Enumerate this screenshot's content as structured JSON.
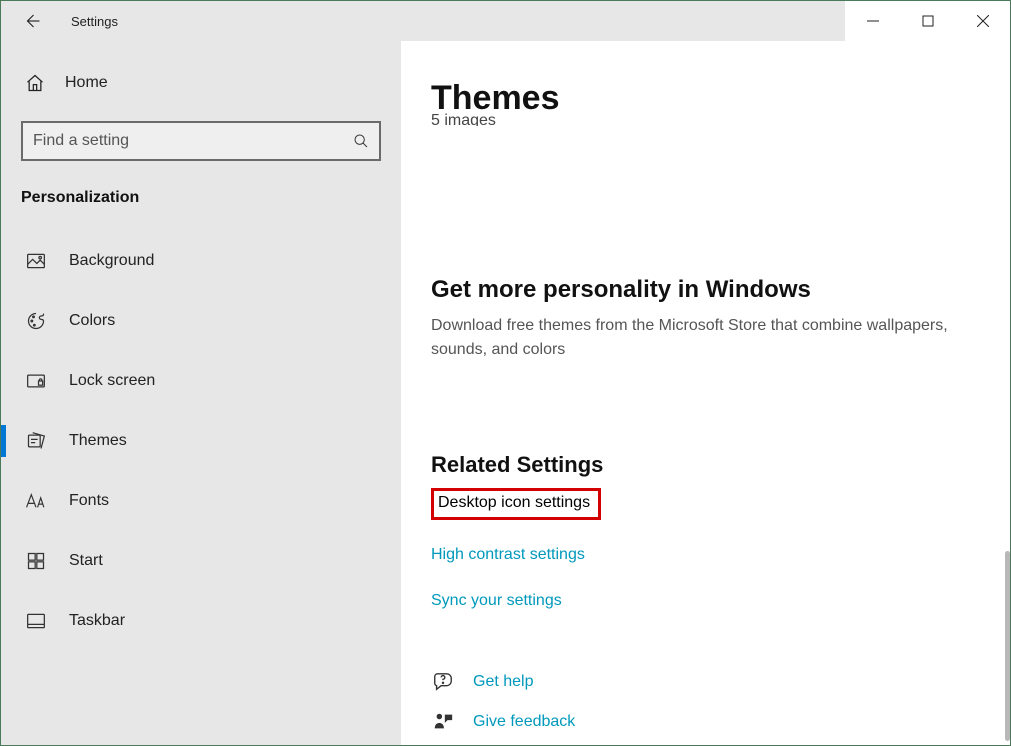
{
  "window": {
    "title": "Settings"
  },
  "sidebar": {
    "home_label": "Home",
    "search_placeholder": "Find a setting",
    "section_label": "Personalization",
    "items": [
      {
        "label": "Background",
        "icon": "image-icon",
        "active": false
      },
      {
        "label": "Colors",
        "icon": "palette-icon",
        "active": false
      },
      {
        "label": "Lock screen",
        "icon": "lockscreen-icon",
        "active": false
      },
      {
        "label": "Themes",
        "icon": "themes-icon",
        "active": true
      },
      {
        "label": "Fonts",
        "icon": "fonts-icon",
        "active": false
      },
      {
        "label": "Start",
        "icon": "start-icon",
        "active": false
      },
      {
        "label": "Taskbar",
        "icon": "taskbar-icon",
        "active": false
      }
    ]
  },
  "main": {
    "title": "Themes",
    "clipped_line": "5 images",
    "more_title": "Get more personality in Windows",
    "more_desc": "Download free themes from the Microsoft Store that combine wallpapers, sounds, and colors",
    "related_title": "Related Settings",
    "links": [
      "Desktop icon settings",
      "High contrast settings",
      "Sync your settings"
    ],
    "help_label": "Get help",
    "feedback_label": "Give feedback"
  },
  "colors": {
    "accent_link": "#0099bc",
    "highlight_border": "#d40000"
  }
}
